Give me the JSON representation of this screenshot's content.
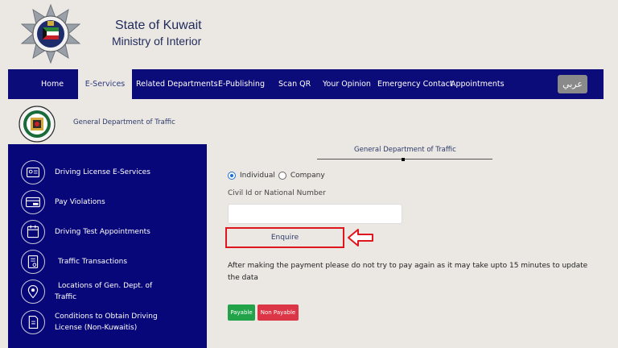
{
  "header": {
    "title_line1": "State of Kuwait",
    "title_line2": "Ministry of Interior",
    "logo_icon": "kuwait-police-star-emblem"
  },
  "nav": {
    "items": [
      {
        "label": "Home",
        "active": false
      },
      {
        "label": "E-Services",
        "active": true
      },
      {
        "label": "Related Departments",
        "active": false
      },
      {
        "label": "E-Publishing",
        "active": false
      },
      {
        "label": "Scan QR",
        "active": false
      },
      {
        "label": "Your Opinion",
        "active": false
      },
      {
        "label": "Emergency Contact",
        "active": false
      },
      {
        "label": "Appointments",
        "active": false
      }
    ],
    "language_button": "عربي"
  },
  "department": {
    "title": "General Department of Traffic",
    "logo_icon": "traffic-department-emblem"
  },
  "sidebar": {
    "items": [
      {
        "label": "Driving License E-Services",
        "icon": "driving-license-icon"
      },
      {
        "label": "Pay Violations",
        "icon": "payment-card-icon"
      },
      {
        "label": "Driving Test Appointments",
        "icon": "calendar-icon"
      },
      {
        "label": "Traffic Transactions",
        "icon": "document-stamp-icon"
      },
      {
        "label_line1": "Locations of Gen. Dept. of",
        "label_line2": "Traffic",
        "icon": "location-pin-icon"
      },
      {
        "label_line1": "Conditions to Obtain Driving",
        "label_line2": "License (Non-Kuwaitis)",
        "icon": "pdf-document-icon"
      }
    ]
  },
  "main": {
    "title": "General Department of Traffic",
    "radio_individual": "Individual",
    "radio_company": "Company",
    "selected": "Individual",
    "civil_label": "Civil Id or National Number",
    "civil_value": "",
    "enquire_label": "Enquire",
    "note": "After making the payment please do not try to pay again as it may take upto 15 minutes to update the data",
    "payable_label": "Payable",
    "non_payable_label": "Non Payable"
  },
  "colors": {
    "nav_bg": "#0c0b7a",
    "sidebar_bg": "#08077a",
    "page_bg": "#ebe8e3",
    "highlight_red": "#e0161f",
    "payable_green": "#22a349",
    "non_payable_red": "#dc3545"
  }
}
